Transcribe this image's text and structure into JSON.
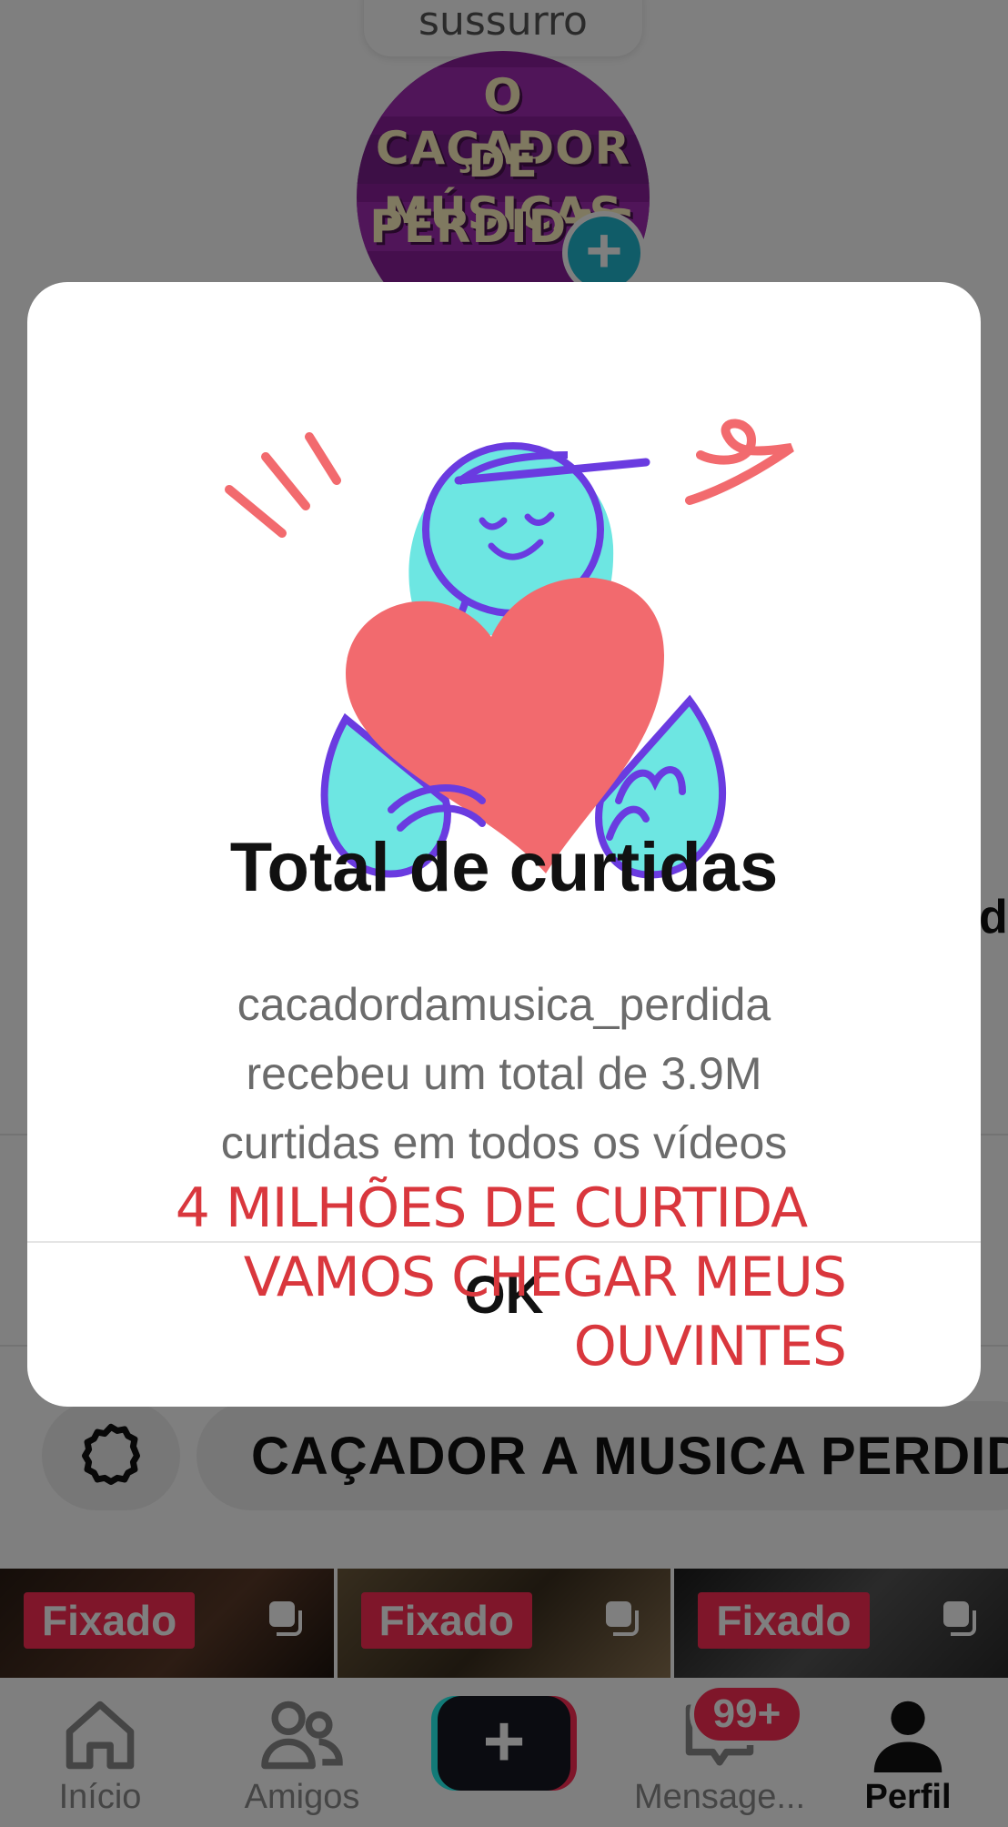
{
  "profile": {
    "whisper_label": "sussurro",
    "avatar_lines": [
      "O CAÇADOR",
      "DE MÚSICAS",
      "PERDIDAS"
    ],
    "avatar_plus": "+",
    "edge_letter": "d",
    "playlist_label": "CAÇADOR A MUSICA PERDIDA",
    "pinned_label": "Fixado"
  },
  "thumbnails": [
    {
      "badge": "Fixado"
    },
    {
      "badge": "Fixado"
    },
    {
      "badge": "Fixado"
    }
  ],
  "modal": {
    "title": "Total de curtidas",
    "body_line1": "cacadordamusica_perdida",
    "body_line2": "recebeu um total de 3.9M",
    "body_line3": "curtidas em todos os vídeos",
    "ok_label": "OK"
  },
  "caption": {
    "line1": "4 MILHÕES DE CURTIDA",
    "line2": "VAMOS CHEGAR MEUS",
    "line3": "OUVINTES",
    "color": "#d9373d"
  },
  "nav": {
    "home_label": "Início",
    "friends_label": "Amigos",
    "create_label": "+",
    "inbox_label": "Mensage...",
    "inbox_badge": "99+",
    "profile_label": "Perfil"
  },
  "icons": {
    "settings": "gear-icon",
    "playlist": "playlist-icon",
    "home": "home-icon",
    "friends": "friends-icon",
    "inbox": "message-icon",
    "profile": "person-icon",
    "multi": "multiple-items-icon"
  },
  "colors": {
    "brand_red": "#fe2c55",
    "brand_cyan": "#25f4ee",
    "heart": "#f26a6e",
    "figure": "#6de6e2",
    "outline": "#6a3be0"
  }
}
